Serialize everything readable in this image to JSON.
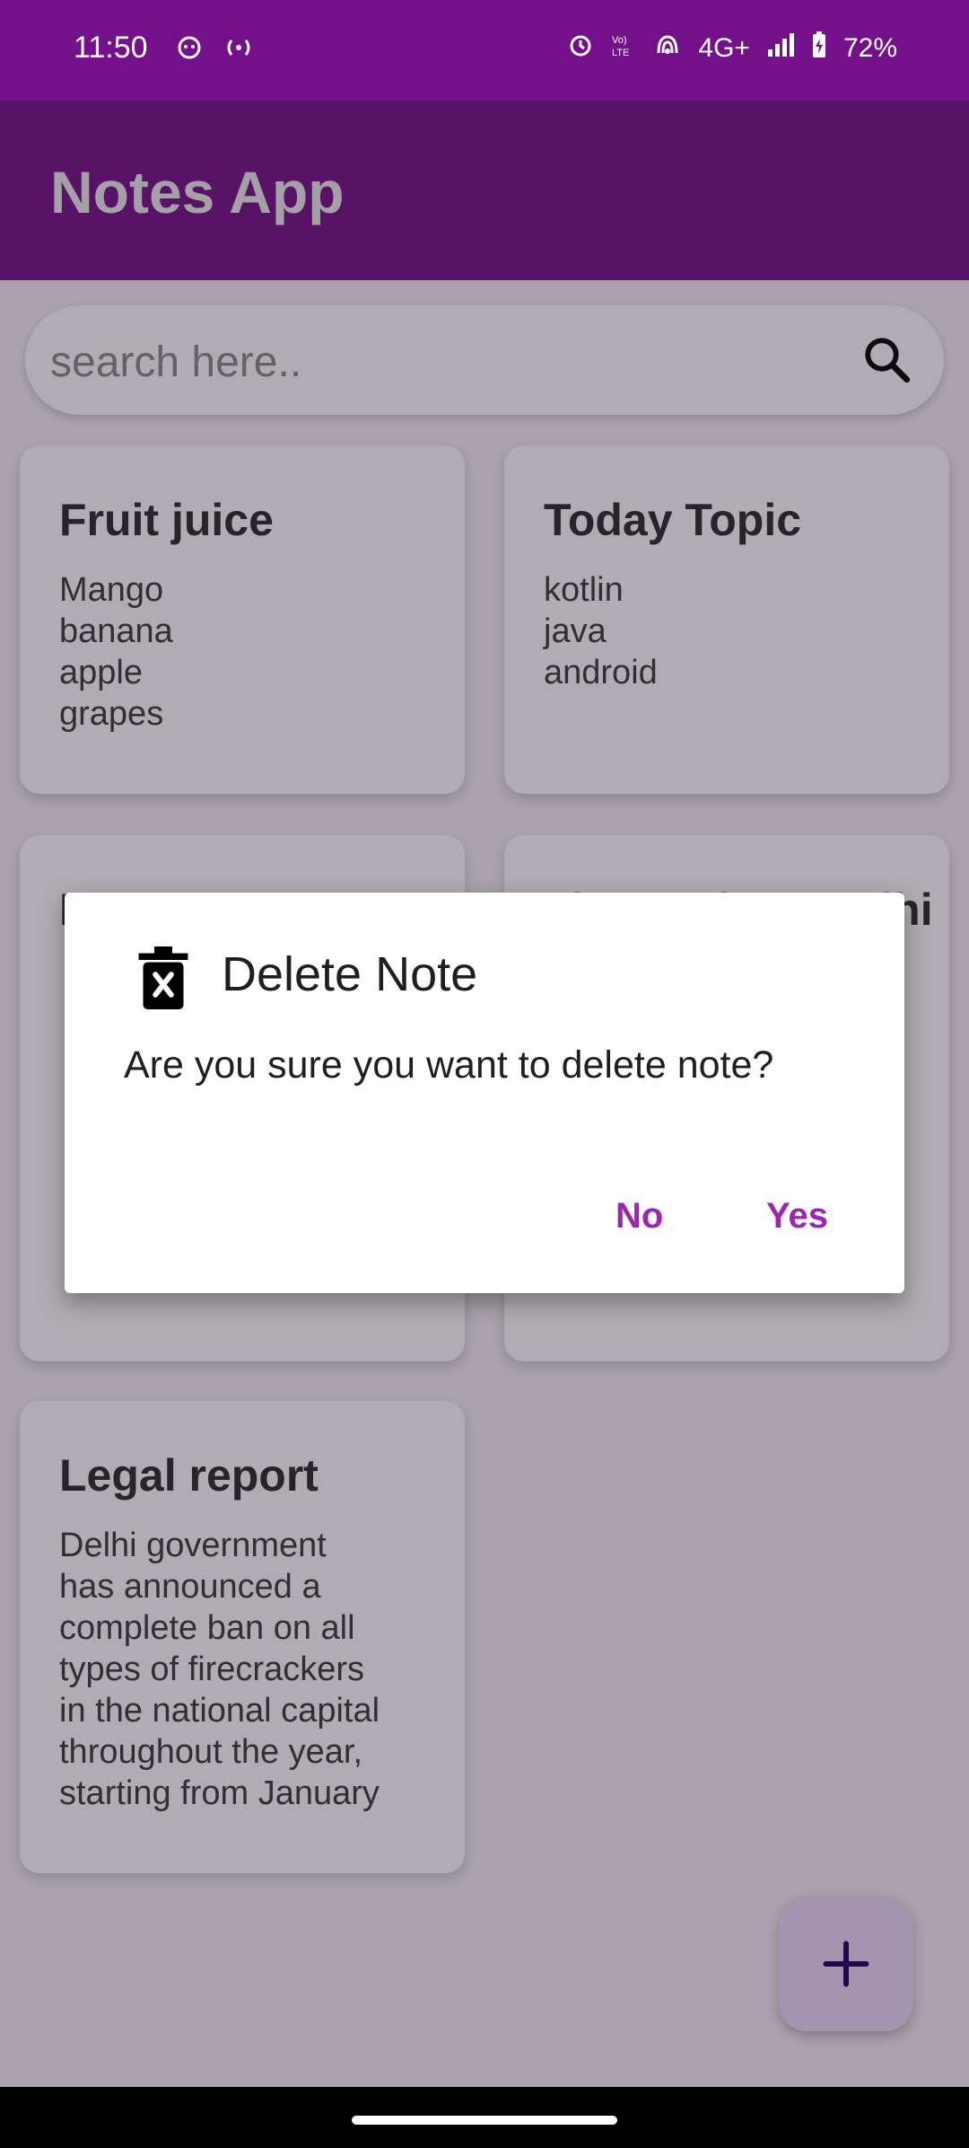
{
  "status_bar": {
    "time": "11:50",
    "network": "4G+",
    "battery": "72%"
  },
  "app_bar": {
    "title": "Notes App"
  },
  "search": {
    "placeholder": "search here.."
  },
  "notes": [
    {
      "title": "Fruit juice",
      "body": "Mango\nbanana\napple\ngrapes"
    },
    {
      "title": "Today Topic",
      "body": "kotlin\njava\nandroid"
    },
    {
      "title": "ENTERTAINMENT",
      "body": ""
    },
    {
      "title": "Firecrackers Delhi",
      "body": ""
    },
    {
      "title": "Legal report",
      "body": "Delhi government\nhas announced a\ncomplete ban on all\ntypes of firecrackers\nin the national capital\nthroughout the year,\nstarting from January"
    }
  ],
  "dialog": {
    "title": "Delete Note",
    "message": "Are you sure you want to delete note?",
    "no_label": "No",
    "yes_label": "Yes"
  },
  "colors": {
    "primary": "#741089",
    "accent": "#9b27b0",
    "fab": "#e9dcfb"
  },
  "icons": {
    "search": "search-icon",
    "delete": "trash-x-icon",
    "add": "plus-icon"
  }
}
